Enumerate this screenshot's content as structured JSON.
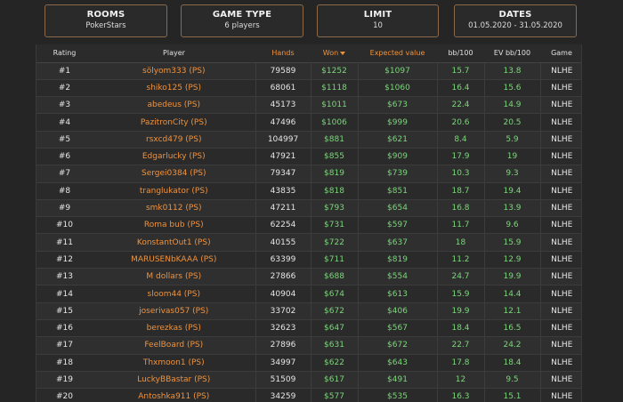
{
  "filters": {
    "rooms": {
      "title": "ROOMS",
      "value": "PokerStars"
    },
    "game_type": {
      "title": "GAME TYPE",
      "value": "6 players"
    },
    "limit": {
      "title": "LIMIT",
      "value": "10"
    },
    "dates": {
      "title": "DATES",
      "value": "01.05.2020 - 31.05.2020"
    }
  },
  "table": {
    "headers": {
      "rating": "Rating",
      "player": "Player",
      "hands": "Hands",
      "won": "Won",
      "expected_value": "Expected value",
      "bb100": "bb/100",
      "ev_bb100": "EV bb/100",
      "game": "Game"
    },
    "sort_icon": "caret-down-icon",
    "colors": {
      "accent": "#f0923c",
      "positive": "#7bd67b",
      "border": "#8a6a4a"
    },
    "rows": [
      {
        "rank": "#1",
        "player": "sölyom333 (PS)",
        "hands": "79589",
        "won": "$1252",
        "ev": "$1097",
        "bb100": "15.7",
        "evbb100": "13.8",
        "game": "NLHE"
      },
      {
        "rank": "#2",
        "player": "shiko125 (PS)",
        "hands": "68061",
        "won": "$1118",
        "ev": "$1060",
        "bb100": "16.4",
        "evbb100": "15.6",
        "game": "NLHE"
      },
      {
        "rank": "#3",
        "player": "abedeus (PS)",
        "hands": "45173",
        "won": "$1011",
        "ev": "$673",
        "bb100": "22.4",
        "evbb100": "14.9",
        "game": "NLHE"
      },
      {
        "rank": "#4",
        "player": "PazitronCity (PS)",
        "hands": "47496",
        "won": "$1006",
        "ev": "$999",
        "bb100": "20.6",
        "evbb100": "20.5",
        "game": "NLHE"
      },
      {
        "rank": "#5",
        "player": "rsxcd479 (PS)",
        "hands": "104997",
        "won": "$881",
        "ev": "$621",
        "bb100": "8.4",
        "evbb100": "5.9",
        "game": "NLHE"
      },
      {
        "rank": "#6",
        "player": "Edgarlucky (PS)",
        "hands": "47921",
        "won": "$855",
        "ev": "$909",
        "bb100": "17.9",
        "evbb100": "19",
        "game": "NLHE"
      },
      {
        "rank": "#7",
        "player": "Sergei0384 (PS)",
        "hands": "79347",
        "won": "$819",
        "ev": "$739",
        "bb100": "10.3",
        "evbb100": "9.3",
        "game": "NLHE"
      },
      {
        "rank": "#8",
        "player": "tranglukator (PS)",
        "hands": "43835",
        "won": "$818",
        "ev": "$851",
        "bb100": "18.7",
        "evbb100": "19.4",
        "game": "NLHE"
      },
      {
        "rank": "#9",
        "player": "smk0112 (PS)",
        "hands": "47211",
        "won": "$793",
        "ev": "$654",
        "bb100": "16.8",
        "evbb100": "13.9",
        "game": "NLHE"
      },
      {
        "rank": "#10",
        "player": "Roma bub (PS)",
        "hands": "62254",
        "won": "$731",
        "ev": "$597",
        "bb100": "11.7",
        "evbb100": "9.6",
        "game": "NLHE"
      },
      {
        "rank": "#11",
        "player": "KonstantOut1 (PS)",
        "hands": "40155",
        "won": "$722",
        "ev": "$637",
        "bb100": "18",
        "evbb100": "15.9",
        "game": "NLHE"
      },
      {
        "rank": "#12",
        "player": "MARUSENbKAAA (PS)",
        "hands": "63399",
        "won": "$711",
        "ev": "$819",
        "bb100": "11.2",
        "evbb100": "12.9",
        "game": "NLHE"
      },
      {
        "rank": "#13",
        "player": "M dollars (PS)",
        "hands": "27866",
        "won": "$688",
        "ev": "$554",
        "bb100": "24.7",
        "evbb100": "19.9",
        "game": "NLHE"
      },
      {
        "rank": "#14",
        "player": "sloom44 (PS)",
        "hands": "40904",
        "won": "$674",
        "ev": "$613",
        "bb100": "15.9",
        "evbb100": "14.4",
        "game": "NLHE"
      },
      {
        "rank": "#15",
        "player": "joserivas057 (PS)",
        "hands": "33702",
        "won": "$672",
        "ev": "$406",
        "bb100": "19.9",
        "evbb100": "12.1",
        "game": "NLHE"
      },
      {
        "rank": "#16",
        "player": "berezkas (PS)",
        "hands": "32623",
        "won": "$647",
        "ev": "$567",
        "bb100": "18.4",
        "evbb100": "16.5",
        "game": "NLHE"
      },
      {
        "rank": "#17",
        "player": "FeelBoard (PS)",
        "hands": "27896",
        "won": "$631",
        "ev": "$672",
        "bb100": "22.7",
        "evbb100": "24.2",
        "game": "NLHE"
      },
      {
        "rank": "#18",
        "player": "Thxmoon1 (PS)",
        "hands": "34997",
        "won": "$622",
        "ev": "$643",
        "bb100": "17.8",
        "evbb100": "18.4",
        "game": "NLHE"
      },
      {
        "rank": "#19",
        "player": "LuckyBBastar (PS)",
        "hands": "51509",
        "won": "$617",
        "ev": "$491",
        "bb100": "12",
        "evbb100": "9.5",
        "game": "NLHE"
      },
      {
        "rank": "#20",
        "player": "Antoshka911 (PS)",
        "hands": "34259",
        "won": "$577",
        "ev": "$535",
        "bb100": "16.3",
        "evbb100": "15.1",
        "game": "NLHE"
      }
    ]
  }
}
